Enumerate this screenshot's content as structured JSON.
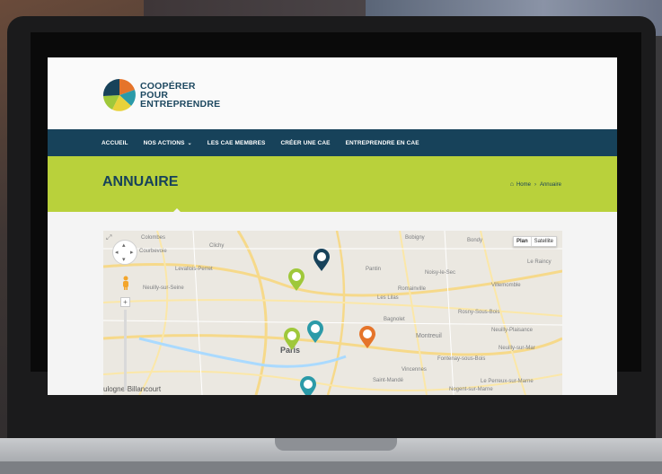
{
  "brand": {
    "line1": "COOPÉRER",
    "line2": "POUR",
    "line3": "ENTREPRENDRE",
    "colors": {
      "navy": "#17425a",
      "green": "#b9d13b",
      "orange": "#e5742a",
      "teal": "#2b9aa8",
      "yellow": "#e8d23a"
    }
  },
  "nav": {
    "items": [
      {
        "label": "ACCUEIL"
      },
      {
        "label": "NOS ACTIONS",
        "has_dropdown": true
      },
      {
        "label": "LES CAE MEMBRES"
      },
      {
        "label": "CRÉER UNE CAE"
      },
      {
        "label": "ENTREPRENDRE EN CAE"
      }
    ],
    "caret": "⌄"
  },
  "band": {
    "title": "ANNUAIRE",
    "breadcrumb": {
      "home_icon": "home-icon",
      "home_label": "Home",
      "separator": "›",
      "current": "Annuaire"
    }
  },
  "map": {
    "type_toggle": {
      "plan": "Plan",
      "satellite": "Satellite",
      "selected": "Plan"
    },
    "zoom_plus": "+",
    "labels": [
      {
        "text": "Colombes"
      },
      {
        "text": "Clichy"
      },
      {
        "text": "Bobigny"
      },
      {
        "text": "Bondy"
      },
      {
        "text": "Courbevoie"
      },
      {
        "text": "Levallois-Perret"
      },
      {
        "text": "Pantin"
      },
      {
        "text": "Le Raincy"
      },
      {
        "text": "Noisy-le-Sec"
      },
      {
        "text": "Neuilly-sur-Seine"
      },
      {
        "text": "Romainville"
      },
      {
        "text": "Villemomble"
      },
      {
        "text": "Les Lilas"
      },
      {
        "text": "Rosny-Sous-Bois"
      },
      {
        "text": "Bagnolet"
      },
      {
        "text": "Neuilly-Plaisance"
      },
      {
        "text": "Montreuil"
      },
      {
        "text": "Neuilly-sur-Mar"
      },
      {
        "text": "Paris"
      },
      {
        "text": "Fontenay-sous-Bois"
      },
      {
        "text": "Vincennes"
      },
      {
        "text": "Saint-Mandé"
      },
      {
        "text": "Le Perreux-sur-Marne"
      },
      {
        "text": "Nogent-sur-Marne"
      },
      {
        "text": "ulogne-Billancourt"
      }
    ],
    "pins": [
      {
        "color": "#17425a"
      },
      {
        "color": "#9fc83a"
      },
      {
        "color": "#2b9aa8"
      },
      {
        "color": "#9fc83a"
      },
      {
        "color": "#e5742a"
      },
      {
        "color": "#2b9aa8"
      }
    ]
  }
}
